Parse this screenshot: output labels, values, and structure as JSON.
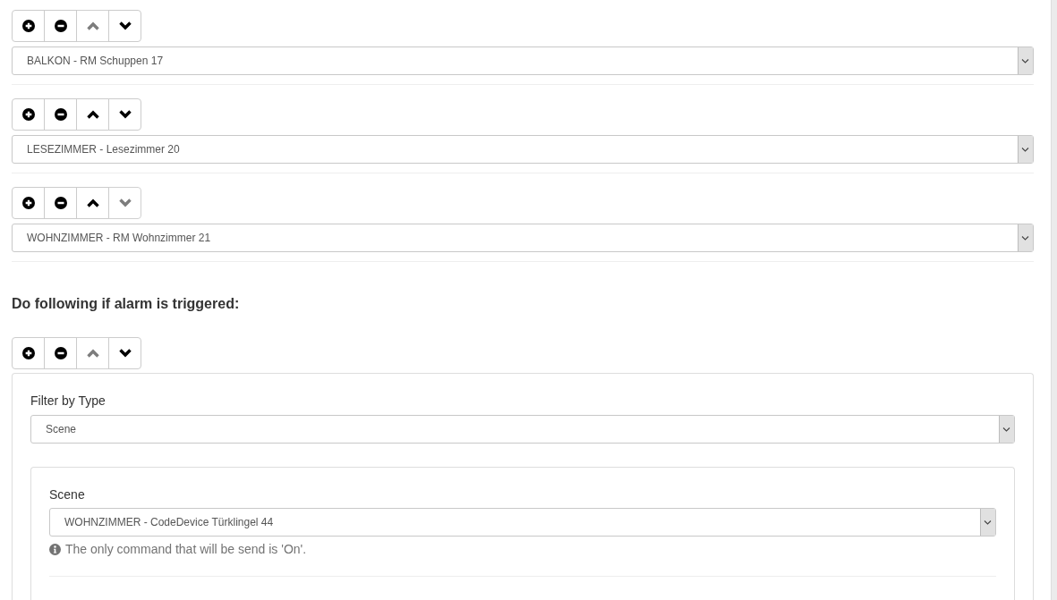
{
  "sensor_rows": [
    {
      "buttons": [
        {
          "kind": "add",
          "disabled": false
        },
        {
          "kind": "remove",
          "disabled": false
        },
        {
          "kind": "up",
          "disabled": true
        },
        {
          "kind": "down",
          "disabled": false
        }
      ],
      "value": "BALKON - RM Schuppen 17"
    },
    {
      "buttons": [
        {
          "kind": "add",
          "disabled": false
        },
        {
          "kind": "remove",
          "disabled": false
        },
        {
          "kind": "up",
          "disabled": false
        },
        {
          "kind": "down",
          "disabled": false
        }
      ],
      "value": "LESEZIMMER - Lesezimmer 20"
    },
    {
      "buttons": [
        {
          "kind": "add",
          "disabled": false
        },
        {
          "kind": "remove",
          "disabled": false
        },
        {
          "kind": "up",
          "disabled": false
        },
        {
          "kind": "down",
          "disabled": true
        }
      ],
      "value": "WOHNZIMMER - RM Wohnzimmer 21"
    }
  ],
  "alarm_section": {
    "heading": "Do following if alarm is triggered:",
    "actions": [
      {
        "buttons": [
          {
            "kind": "add",
            "disabled": false
          },
          {
            "kind": "remove",
            "disabled": false
          },
          {
            "kind": "up",
            "disabled": true
          },
          {
            "kind": "down",
            "disabled": false
          }
        ],
        "filter": {
          "label": "Filter by Type",
          "value": "Scene"
        },
        "target": {
          "label": "Scene",
          "value": "WOHNZIMMER - CodeDevice Türklingel 44",
          "help": "The only command that will be send is 'On'."
        }
      }
    ]
  }
}
